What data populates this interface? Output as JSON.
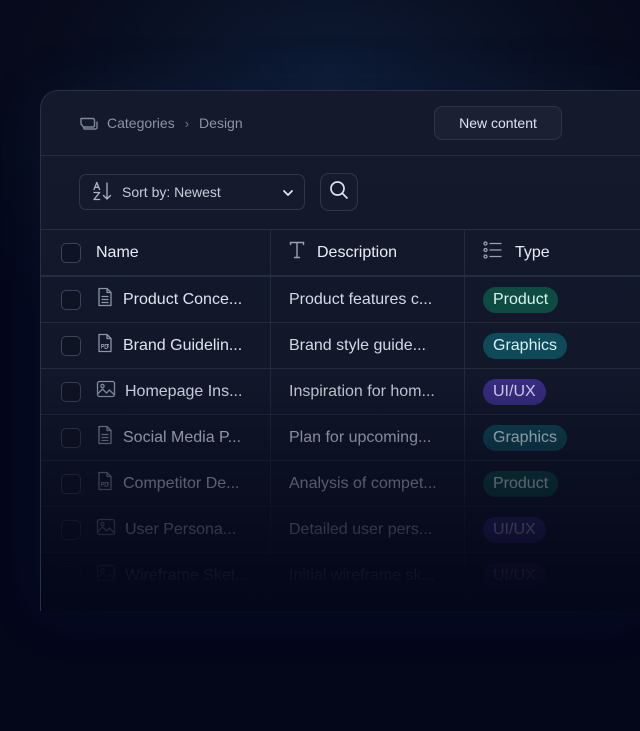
{
  "breadcrumb": {
    "root": "Categories",
    "separator": "›",
    "current": "Design"
  },
  "header": {
    "new_button": "New content"
  },
  "toolbar": {
    "sort_label": "Sort by: Newest"
  },
  "table": {
    "columns": {
      "name": "Name",
      "description": "Description",
      "type": "Type"
    },
    "rows": [
      {
        "name": "Product Conce...",
        "description": "Product features c...",
        "type": "Product",
        "icon": "document-icon"
      },
      {
        "name": "Brand Guidelin...",
        "description": "Brand style guide...",
        "type": "Graphics",
        "icon": "pdf-icon"
      },
      {
        "name": "Homepage Ins...",
        "description": "Inspiration for hom...",
        "type": "UI/UX",
        "icon": "image-icon"
      },
      {
        "name": "Social Media P...",
        "description": "Plan for upcoming...",
        "type": "Graphics",
        "icon": "document-icon"
      },
      {
        "name": "Competitor De...",
        "description": "Analysis of compet...",
        "type": "Product",
        "icon": "pdf-icon"
      },
      {
        "name": "User Persona...",
        "description": "Detailed user pers...",
        "type": "UI/UX",
        "icon": "image-icon"
      },
      {
        "name": "Wireframe Sket...",
        "description": "Initial wireframe sk...",
        "type": "UI/UX",
        "icon": "image-icon"
      }
    ]
  },
  "colors": {
    "product": "#0d4b43",
    "graphics": "#0f4a58",
    "uiux": "#3a2e86",
    "background": "#04061a"
  }
}
